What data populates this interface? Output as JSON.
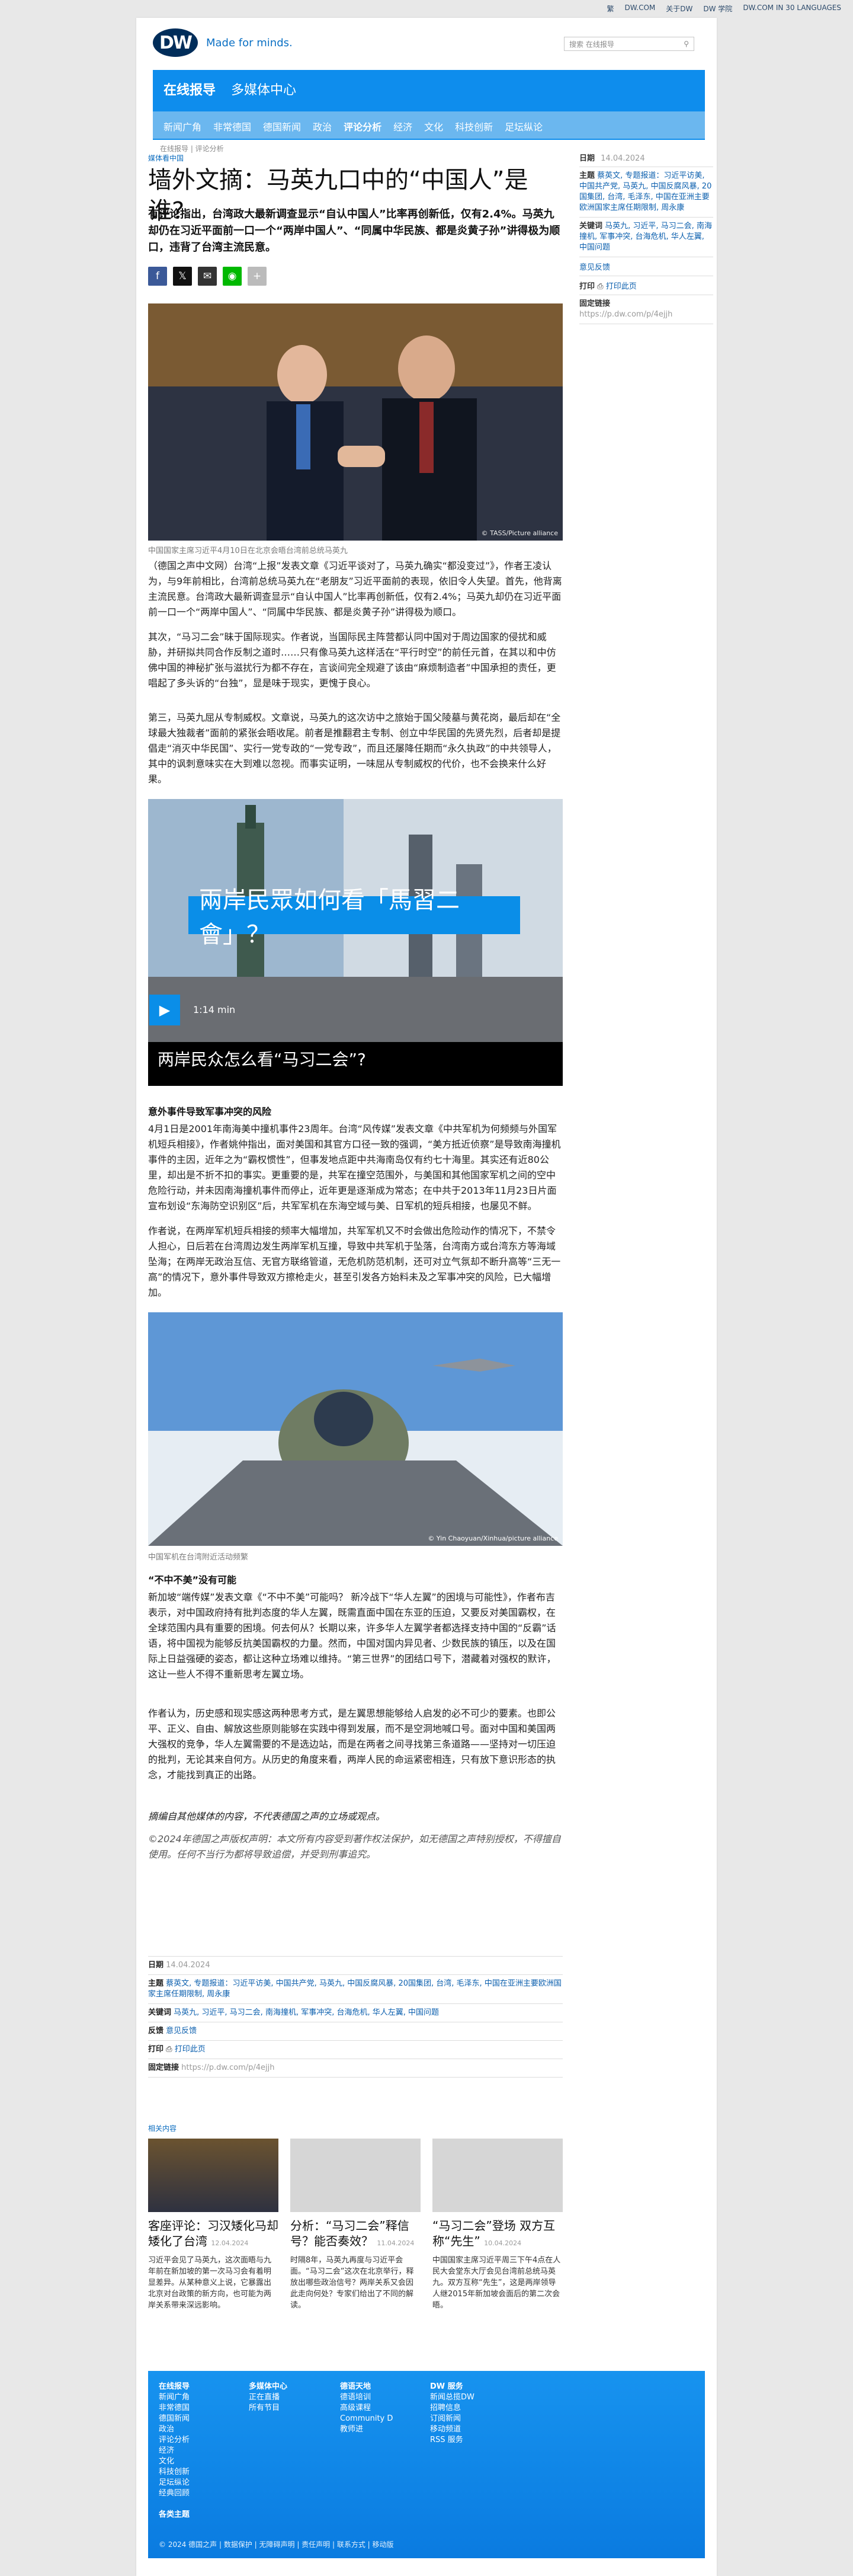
{
  "topbar": {
    "links": [
      "繁",
      "DW.COM",
      "关于DW",
      "DW 学院",
      "DW.COM IN 30 LANGUAGES"
    ]
  },
  "header": {
    "logo": "DW",
    "tagline": "Made for minds.",
    "search_placeholder": "搜索 在线报导",
    "search_icon": "magnifier"
  },
  "nav": {
    "primary": [
      "在线报导",
      "多媒体中心"
    ],
    "secondary": [
      "新闻广角",
      "非常德国",
      "德国新闻",
      "政治",
      "评论分析",
      "经济",
      "文化",
      "科技创新",
      "足坛纵论"
    ],
    "active_secondary": "评论分析"
  },
  "breadcrumb": "在线报导 | 评论分析",
  "article": {
    "kicker": "媒体看中国",
    "title": "墙外文摘：马英九口中的“中国人”是谁?",
    "lead": "有评论指出，台湾政大最新调查显示“自认中国人”比率再创新低，仅有2.4%。马英九却仍在习近平面前一口一个“两岸中国人”、“同属中华民族、都是炎黄子孙”讲得极为顺口，违背了台湾主流民意。",
    "share_icons": [
      "facebook",
      "x",
      "email",
      "line",
      "plus"
    ],
    "image1_caption": "中国国家主席习近平4月10日在北京会晤台湾前总统马英九",
    "image1_credit": "© TASS/Picture alliance",
    "paragraphs1": [
      "（德国之声中文网）台湾“上报”发表文章《习近平谈对了，马英九确实“都没变过”》，作者王凌认为，与9年前相比，台湾前总统马英九在“老朋友”习近平面前的表现，依旧令人失望。首先，他背离主流民意。台湾政大最新调查显示“自认中国人”比率再创新低，仅有2.4%；马英九却仍在习近平面前一口一个“两岸中国人”、“同属中华民族、都是炎黄子孙”讲得极为顺口。",
      "其次，“马习二会”昧于国际现实。作者说，当国际民主阵营都认同中国对于周边国家的侵扰和威胁，并研拟共同合作反制之道时……只有像马英九这样活在“平行时空”的前任元首，在其以和中仿佛中国的神秘扩张与滋扰行为都不存在，言谈间完全规避了该由“麻烦制造者”中国承担的责任，更唱起了多头诉的“台独”，显是味于现实，更愧于良心。",
      "第三，马英九屈从专制威权。文章说，马英九的这次访中之旅始于国父陵墓与黄花岗，最后却在“全球最大独裁者”面前的紧张会晤收尾。前者是推翻君主专制、创立中华民国的先贤先烈，后者却是提倡走“消灭中华民国”、实行一党专政的“一党专政”，而且还屡降任期而“永久执政”的中共领导人，其中的讽刺意味实在大到难以忽视。而事实证明，一味屈从专制威权的代价，也不会换来什么好果。"
    ],
    "video": {
      "banner": "兩岸民眾如何看「馬習二會」？",
      "duration": "1:14 min",
      "title": "两岸民众怎么看“马习二会”?"
    },
    "subheading1": "意外事件导致军事冲突的风险",
    "paragraphs2": [
      "4月1日是2001年南海美中撞机事件23周年。台湾“风传媒”发表文章《中共军机为何频频与外国军机短兵相接》，作者姚仲指出，面对美国和其官方口径一致的强调，“美方抵近侦察”是导致南海撞机事件的主因，近年之为“霸权惯性”，但事发地点距中共海南岛仅有约七十海里。其实还有近80公里，却出是不折不扣的事实。更重要的是，共军在撞空范围外，与美国和其他国家军机之间的空中危险行动，并未因南海撞机事件而停止，近年更是逐渐成为常态；在中共于2013年11月23日片面宣布划设“东海防空识别区”后，共军军机在东海空域与美、日军机的短兵相接，也屡见不鲜。",
      "作者说，在两岸军机短兵相接的频率大幅增加，共军军机又不时会做出危险动作的情况下，不禁令人担心，日后若在台湾周边发生两岸军机互撞，导致中共军机于坠落，台湾南方或台湾东方等海域坠海；在两岸无政治互信、无官方联络管道，无危机防范机制，还可对立气氛却不断升高等“三无一高”的情况下，意外事件导致双方擦枪走火，甚至引发各方始料未及之军事冲突的风险，已大幅增加。"
    ],
    "image2_caption": "中国军机在台湾附近活动频繁",
    "image2_credit": "© Yin Chaoyuan/Xinhua/picture alliance",
    "subheading2": "“不中不美”没有可能",
    "paragraphs3": [
      "新加坡“端传媒”发表文章《“不中不美”可能吗？ 新冷战下“华人左翼”的困境与可能性》，作者布吉表示，对中国政府持有批判态度的华人左翼，既需直面中国在东亚的压迫，又要反对美国霸权，在全球范围内具有重要的困境。何去何从？长期以来，许多华人左翼学者都选择支持中国的“反霸”话语，将中国视为能够反抗美国霸权的力量。然而，中国对国内异见者、少数民族的镇压，以及在国际上日益强硬的姿态，都让这种立场难以维持。“第三世界”的团结口号下，潜藏着对强权的默许，这让一些人不得不重新思考左翼立场。",
      "作者认为，历史感和现实感这两种思考方式，是左翼思想能够给人启发的必不可少的要素。也即公平、正义、自由、解放这些原则能够在实践中得到发展，而不是空洞地喊口号。面对中国和美国两大强权的竞争，华人左翼需要的不是选边站，而是在两者之间寻找第三条道路——坚持对一切压迫的批判，无论其来自何方。从历史的角度来看，两岸人民的命运紧密相连，只有放下意识形态的执念，才能找到真正的出路。"
    ],
    "disclaimer": "摘编自其他媒体的内容，不代表德国之声的立场或观点。",
    "copyright_note": "©2024年德国之声版权声明：本文所有内容受到著作权法保护，如无德国之声特别授权，不得擅自使用。任何不当行为都将导致追偿，并受到刑事追究。"
  },
  "sidebar": {
    "date_label": "日期",
    "date": "14.04.2024",
    "topics_label": "主题",
    "topics": "蔡英文, 专题报道：习近平访美, 中国共产党, 马英九, 中国反腐风暴, 20国集团, 台湾, 毛泽东, 中国在亚洲主要欧洲国家主席任期限制, 周永康",
    "keywords_label": "关键词",
    "keywords": "马英九, 习近平, 马习二会, 南海撞机, 军事冲突, 台海危机, 华人左翼, 中国问题",
    "feedback": "意见反馈",
    "print_label": "打印",
    "print": "打印此页",
    "permalink_label": "固定链接",
    "permalink": "https://p.dw.com/p/4ejjh"
  },
  "meta": {
    "date_label": "日期",
    "date": "14.04.2024",
    "topics_label": "主题",
    "topics": "蔡英文, 专题报道：习近平访美, 中国共产党, 马英九, 中国反腐风暴, 20国集团, 台湾, 毛泽东, 中国在亚洲主要欧洲国家主席任期限制, 周永康",
    "keywords_label": "关键词",
    "keywords": "马英九, 习近平, 马习二会, 南海撞机, 军事冲突, 台海危机, 华人左翼, 中国问题",
    "feedback_label": "反馈",
    "feedback": "意见反馈",
    "print_label": "打印",
    "print": "打印此页",
    "permalink_label": "固定链接",
    "permalink": "https://p.dw.com/p/4ejjh"
  },
  "related": {
    "heading": "相关内容",
    "cards": [
      {
        "title": "客座评论：习汉矮化马却矮化了台湾",
        "date": "12.04.2024",
        "desc": "习近平会见了马英九，这次面晤与九年前在新加坡的第一次马习会有着明显差异。从某种意义上说，它暴露出北京对台政策的新方向，也可能为两岸关系带来深远影响。"
      },
      {
        "title": "分析：“马习二会”释信号？能否奏效？",
        "date": "11.04.2024",
        "desc": "时隔8年，马英九再度与习近平会面。“马习二会”这次在北京举行，释放出哪些政治信号？两岸关系又会因此走向何处？专家们给出了不同的解读。"
      },
      {
        "title": "“马习二会”登场 双方互称“先生”",
        "date": "10.04.2024",
        "desc": "中国国家主席习近平周三下午4点在人民大会堂东大厅会见台湾前总统马英九。双方互称“先生”，这是两岸领导人继2015年新加坡会面后的第二次会晤。"
      }
    ]
  },
  "footer": {
    "cols": [
      {
        "heading": "在线报导",
        "items": [
          "新闻广角",
          "非常德国",
          "德国新闻",
          "政治",
          "评论分析",
          "经济",
          "文化",
          "科技创新",
          "足坛纵论",
          "经典回顾"
        ]
      },
      {
        "heading": "多媒体中心",
        "items": [
          "正在直播",
          "所有节目"
        ]
      },
      {
        "heading": "德语天地",
        "items": [
          "德语培训",
          "高级课程",
          "Community D",
          "教师进"
        ]
      },
      {
        "heading": "DW 服务",
        "items": [
          "新闻总揽DW",
          "招聘信息",
          "订阅新闻",
          "移动频道",
          "RSS 服务"
        ]
      }
    ],
    "extra": "各类主题",
    "copyright": "© 2024 德国之声 | 数据保护 | 无障碍声明 | 责任声明 | 联系方式 | 移动版"
  }
}
